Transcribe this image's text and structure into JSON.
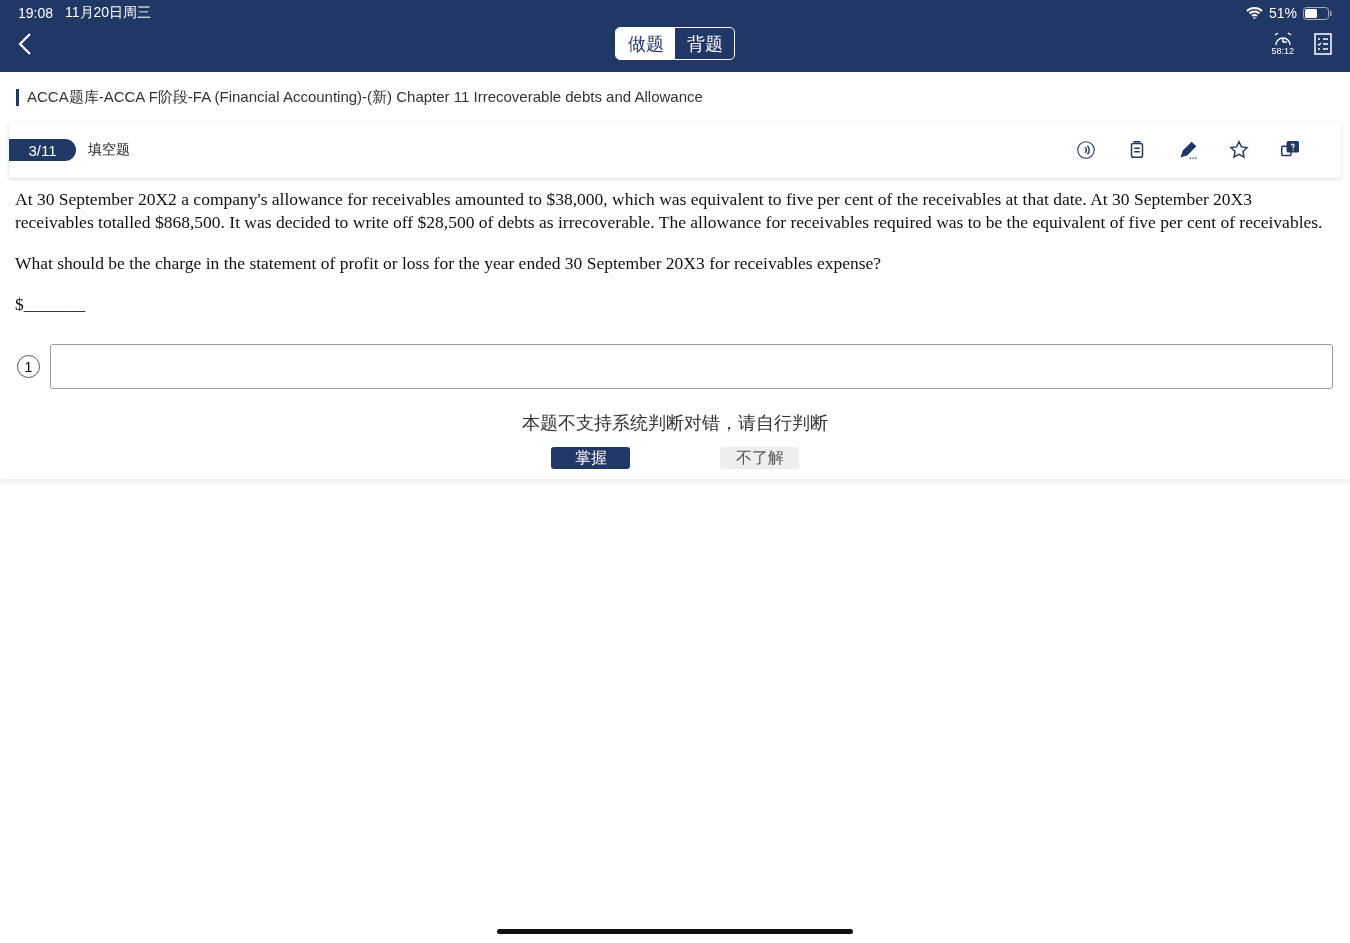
{
  "status_bar": {
    "time": "19:08",
    "date": "11月20日周三",
    "battery": "51%"
  },
  "mode_tabs": [
    {
      "label": "做题",
      "selected": true
    },
    {
      "label": "背题",
      "selected": false
    }
  ],
  "timer": "58:12",
  "breadcrumb": "ACCA题库-ACCA F阶段-FA (Financial Accounting)-(新) Chapter 11 Irrecoverable debts and Allowance",
  "question_header": {
    "progress": "3/11",
    "type": "填空题"
  },
  "question": {
    "paragraphs": [
      "At 30 September 20X2 a company's allowance for receivables amounted to $38,000, which was equivalent to five per cent of the receivables at that date. At 30 September 20X3 receivables totalled $868,500. It was decided to write off $28,500 of debts as irrecoverable. The allowance for receivables required was to be the equivalent of five per cent of receivables.",
      "What should be the charge in the statement of profit or loss for the year ended 30 September 20X3 for receivables expense?",
      "$_______"
    ]
  },
  "answers": [
    {
      "number": "1"
    }
  ],
  "feedback": {
    "message": "本题不支持系统判断对错，请自行判断",
    "buttons": [
      {
        "label": "掌握",
        "kind": "primary"
      },
      {
        "label": "不了解",
        "kind": "secondary"
      }
    ]
  }
}
